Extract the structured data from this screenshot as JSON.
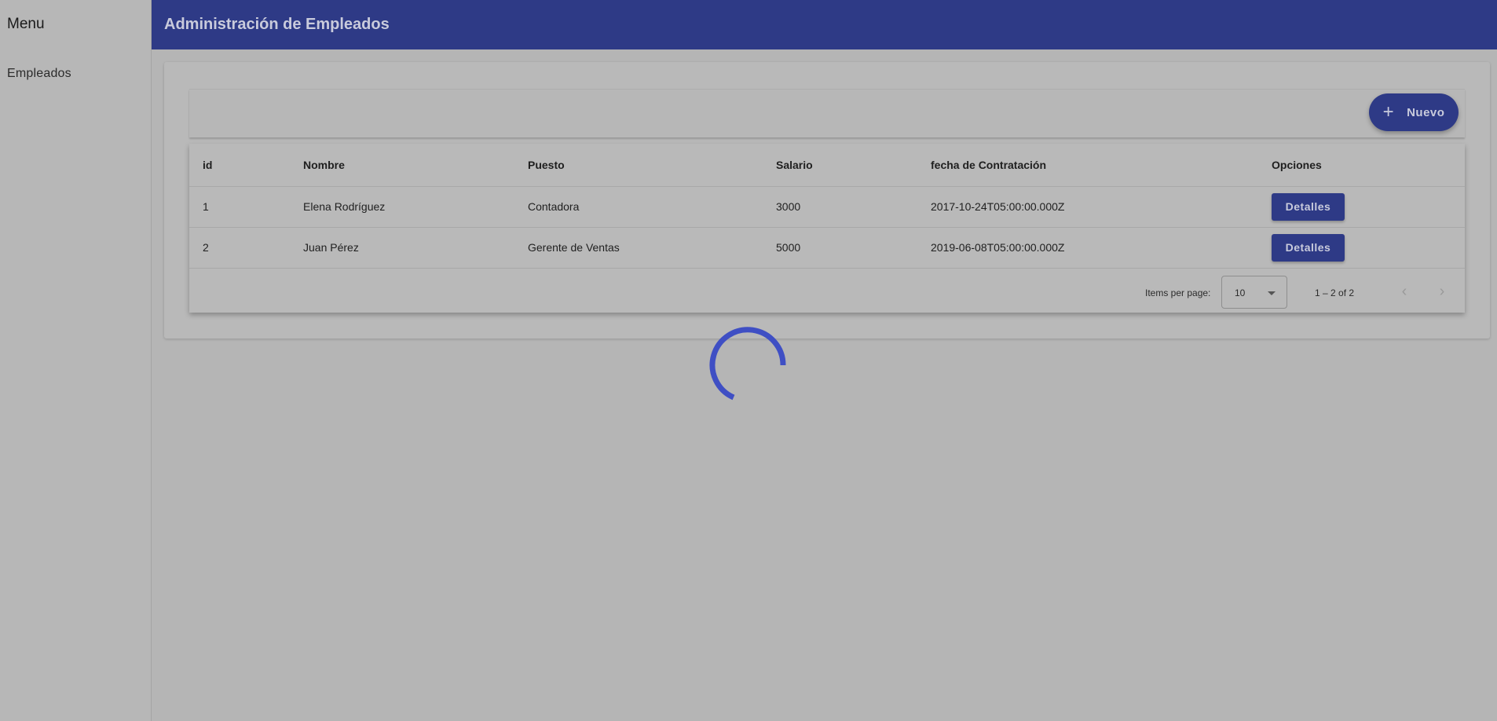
{
  "sidebar": {
    "title": "Menu",
    "items": [
      {
        "label": "Empleados"
      }
    ]
  },
  "header": {
    "title": "Administración de Empleados"
  },
  "toolbar": {
    "new_label": "Nuevo"
  },
  "table": {
    "columns": [
      "id",
      "Nombre",
      "Puesto",
      "Salario",
      "fecha de Contratación",
      "Opciones"
    ],
    "rows": [
      {
        "id": "1",
        "nombre": "Elena Rodríguez",
        "puesto": "Contadora",
        "salario": "3000",
        "fecha": "2017-10-24T05:00:00.000Z",
        "action": "Detalles"
      },
      {
        "id": "2",
        "nombre": "Juan Pérez",
        "puesto": "Gerente de Ventas",
        "salario": "5000",
        "fecha": "2019-06-08T05:00:00.000Z",
        "action": "Detalles"
      }
    ]
  },
  "paginator": {
    "items_per_page_label": "Items per page:",
    "page_size": "10",
    "range_label": "1 – 2 of 2"
  },
  "colors": {
    "primary": "#2e3a86",
    "primary_text": "#c9cbdc",
    "spinner": "#3f4fc4"
  }
}
